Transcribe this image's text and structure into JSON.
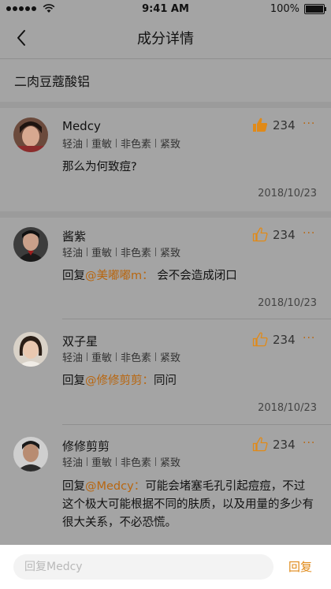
{
  "status_bar": {
    "time": "9:41 AM",
    "battery": "100%",
    "battery_level": 1.0
  },
  "nav": {
    "title": "成分详情"
  },
  "ingredient": {
    "name": "二肉豆蔻酸铝"
  },
  "colors": {
    "accent": "#e08a19",
    "mention": "#b8660f",
    "overlay_bg": "#a4a4a4"
  },
  "comments": [
    {
      "user": "Medcy",
      "tags": [
        "轻油",
        "重敏",
        "非色素",
        "紧致"
      ],
      "likes": "234",
      "liked": true,
      "reply_prefix": "",
      "mention": "",
      "text": "那么为何致痘?",
      "date": "2018/10/23"
    },
    {
      "user": "酱紫",
      "tags": [
        "轻油",
        "重敏",
        "非色素",
        "紧致"
      ],
      "likes": "234",
      "liked": false,
      "reply_prefix": "回复",
      "mention": "@美嘟嘟m：",
      "text": "会不会造成闭口",
      "date": "2018/10/23"
    },
    {
      "user": "双子星",
      "tags": [
        "轻油",
        "重敏",
        "非色素",
        "紧致"
      ],
      "likes": "234",
      "liked": false,
      "reply_prefix": "回复",
      "mention": "@修修剪剪：",
      "text": "同问",
      "date": "2018/10/23"
    },
    {
      "user": "修修剪剪",
      "tags": [
        "轻油",
        "重敏",
        "非色素",
        "紧致"
      ],
      "likes": "234",
      "liked": false,
      "reply_prefix": "回复",
      "mention": "@Medcy：",
      "text": "可能会堵塞毛孔引起痘痘，不过这个极大可能根据不同的肤质，以及用量的多少有很大关系，不必恐慌。",
      "date": ""
    }
  ],
  "reply_bar": {
    "placeholder": "回复Medcy",
    "button": "回复"
  }
}
